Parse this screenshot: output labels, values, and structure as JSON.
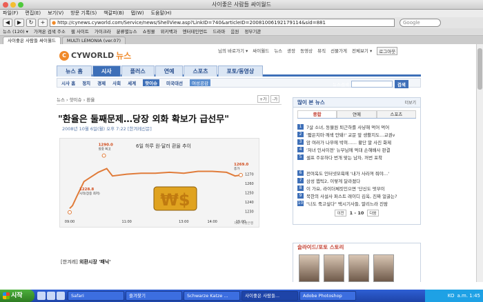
{
  "window": {
    "title": "사이좋은 사람들 싸이월드"
  },
  "menu": [
    "파일(F)",
    "편집(E)",
    "보기(V)",
    "방문 기록(S)",
    "책갈피(B)",
    "탭(W)",
    "도움말(H)"
  ],
  "nav": {
    "url": "http://cynews.cyworld.com/Service/news/ShellView.asp?LinkID=740&articleID=20081006192179114&sid=881",
    "search_placeholder": "Google"
  },
  "bookmarks": [
    "뉴스 (120) ▾",
    "가져온 검색 주소",
    "웹 사이트",
    "가이크라",
    "분류별뉴스",
    "쇼핑몰",
    "위키백과",
    "엔터테인먼트",
    "드라마",
    "음원",
    "정부기관"
  ],
  "tabs": [
    {
      "label": "사이좋은 사람들 싸이월드"
    },
    {
      "label": "MULTI LEMONIA (ver.07)"
    }
  ],
  "site": {
    "logo": {
      "mark": "C",
      "name": "CYWORLD",
      "news": "뉴스"
    },
    "top_links": [
      "님의 바로가기 ▾",
      "싸이월드",
      "뉴스",
      "광장",
      "동영상",
      "뮤직",
      "선물가게",
      "전체보기 ▾"
    ],
    "login": "로그아웃",
    "nav_tabs": [
      "뉴스 홈",
      "시사",
      "플러스",
      "연예",
      "스포츠",
      "포토/동영상"
    ],
    "active_nav": "시사",
    "sub_nav": [
      "시사 홈",
      "정치",
      "경제",
      "사회",
      "세계"
    ],
    "sub_nav_selected": "핫이슈",
    "sub_nav_extra": [
      "미국대선"
    ],
    "sub_nav_badge": "여성공감",
    "news_search_label": "뉴스검색",
    "news_search_button": "검색"
  },
  "article": {
    "breadcrumb": "뉴스 › 핫이슈 › 환율",
    "font_bigger": "+가",
    "font_smaller": "-가",
    "headline": "\"환율은 둘째문제…당장 외화 확보가 급선무\"",
    "dateline": "2008년 10월 6일(월) 오후 7:22 [한겨레신문]",
    "caption_source": "[한겨레]",
    "caption_title": "외환시장 '패닉'"
  },
  "chart_data": {
    "type": "line",
    "title": "6일 하루 원·달러 환율 추이",
    "x_ticks": [
      "09:00",
      "11:00",
      "13:00",
      "14:00",
      "15:00"
    ],
    "x": [
      9.0,
      9.1,
      9.25,
      9.5,
      10.0,
      10.3,
      10.5,
      11.0,
      11.5,
      12.0,
      12.5,
      13.0,
      13.5,
      14.0,
      14.5,
      14.8,
      15.0
    ],
    "y": [
      1233,
      1236,
      1246,
      1262,
      1272,
      1276,
      1268,
      1270,
      1271,
      1271,
      1272,
      1271,
      1273,
      1273,
      1272,
      1268,
      1269
    ],
    "annotations": [
      {
        "label": "1290.0",
        "sub": "장중 최고"
      },
      {
        "label": "1228.8",
        "sub": "시작(장중 최저)"
      },
      {
        "label": "1269.0",
        "sub": "종가"
      }
    ],
    "y_ticks": [
      1230,
      1240,
      1250,
      1260,
      1270
    ],
    "ylim": [
      1225,
      1292
    ],
    "source": "자료: 외환은행"
  },
  "popular": {
    "title": "많이 본 뉴스",
    "more": "더보기",
    "tabs": [
      "종합",
      "연예",
      "스포츠"
    ],
    "items": [
      "7살 소녀, 동물원 퇴근하를 사냥해 먹어 먹어",
      "'짧은치마·깨색 안돼!' 교문 앞 생활지도…교권v",
      "암 여러가 나무에 박혀…… 황단 말 사진 화제",
      "'저녀 인서이전' 뉴부님에 먹대 손해배사 판결",
      "셀프 주유하다 번개 맞는 남자, 꺼번 포착",
      "전여옥도 인터넷모욕에 '내가 사라져 줘야…'",
      "삼성 햅틱2, 이렇게 달라졌다",
      "이 가요, 라이더체킷인으면 '단신도 멋부이",
      "북한의 사설사 퍼스트 레이디 김옥, 진짜 얼굴는?",
      "\"너도 죽고싶다\" 택시기사들, 말리느라 진땀"
    ],
    "page": "1 - 10",
    "prev": "이전",
    "next": "다음"
  },
  "slides": {
    "title": "슬라이드/포토 스토리"
  },
  "taskbar": {
    "start": "시작",
    "tasks": [
      "Safari",
      "즐겨찾기",
      "Schwarze Katze ...",
      "사이좋은 사람들...",
      "Adobe Photoshop"
    ],
    "time": "a.m. 1:45",
    "lang": "KO"
  }
}
